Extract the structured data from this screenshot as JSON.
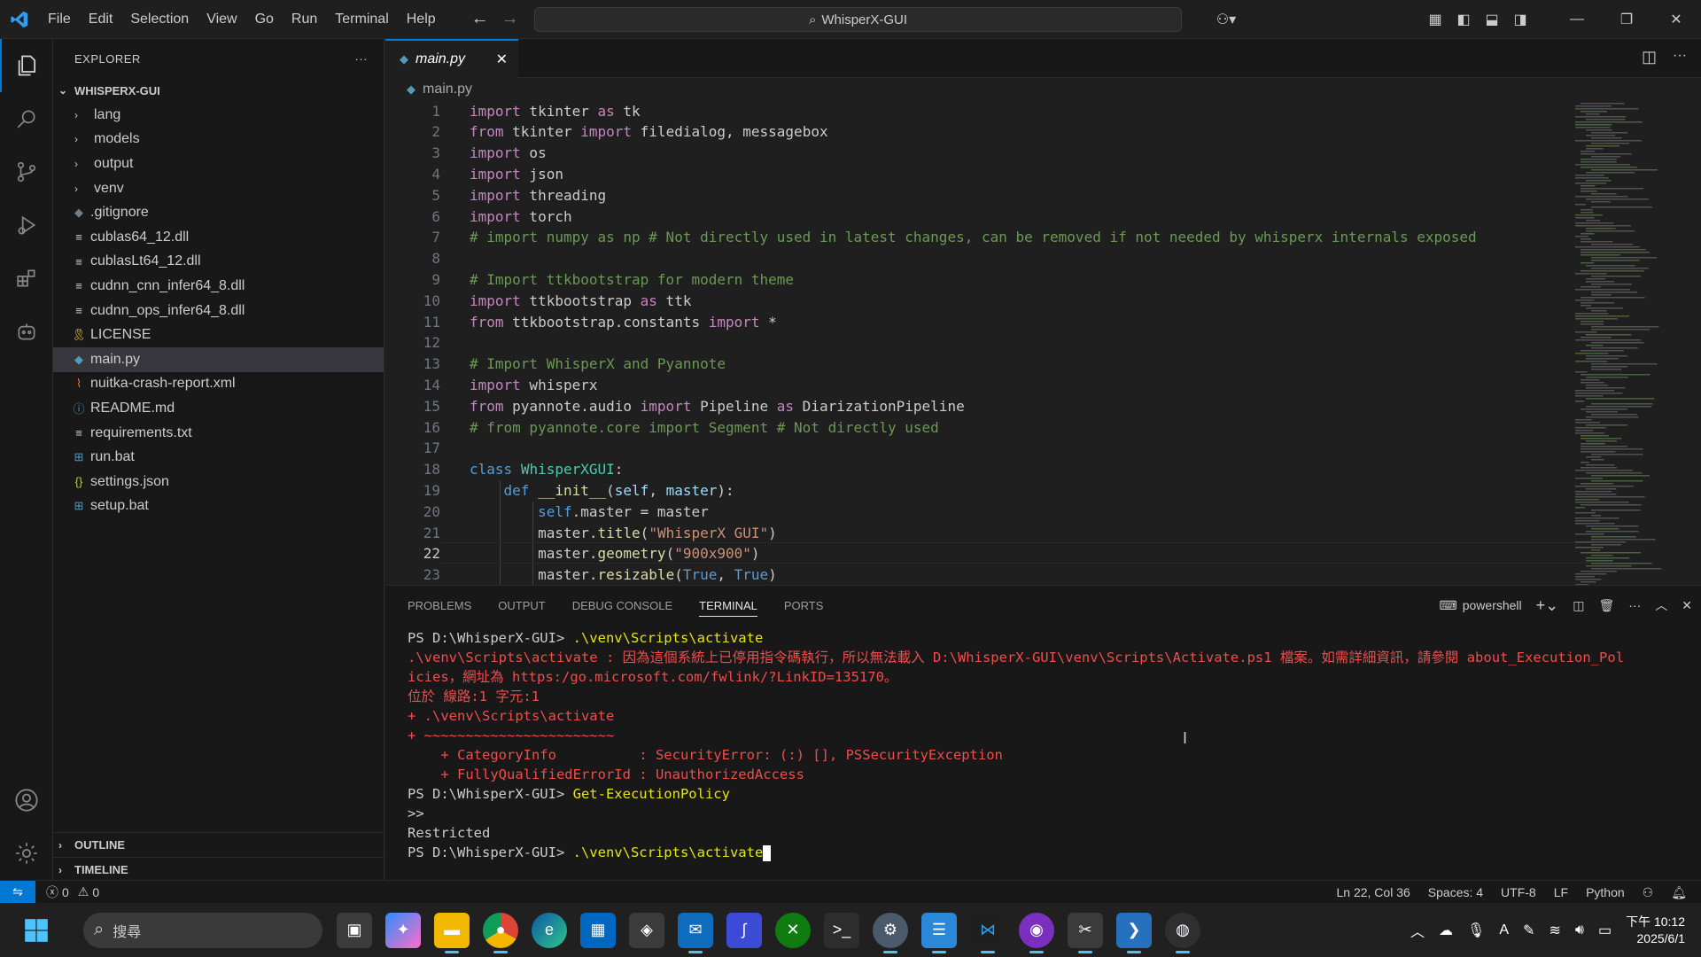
{
  "titlebar": {
    "menus": [
      "File",
      "Edit",
      "Selection",
      "View",
      "Go",
      "Run",
      "Terminal",
      "Help"
    ],
    "search_text": "WhisperX-GUI"
  },
  "explorer": {
    "header": "EXPLORER",
    "root": "WHISPERX-GUI",
    "items": [
      {
        "name": "lang",
        "type": "folder",
        "icon": "folder-chevron"
      },
      {
        "name": "models",
        "type": "folder",
        "icon": "folder-chevron"
      },
      {
        "name": "output",
        "type": "folder",
        "icon": "folder-chevron"
      },
      {
        "name": "venv",
        "type": "folder",
        "icon": "folder-chevron"
      },
      {
        "name": ".gitignore",
        "type": "file",
        "icon": "git-icon",
        "color": "#6d8086"
      },
      {
        "name": "cublas64_12.dll",
        "type": "file",
        "icon": "lines-icon",
        "color": "#cccccc"
      },
      {
        "name": "cublasLt64_12.dll",
        "type": "file",
        "icon": "lines-icon",
        "color": "#cccccc"
      },
      {
        "name": "cudnn_cnn_infer64_8.dll",
        "type": "file",
        "icon": "lines-icon",
        "color": "#cccccc"
      },
      {
        "name": "cudnn_ops_infer64_8.dll",
        "type": "file",
        "icon": "lines-icon",
        "color": "#cccccc"
      },
      {
        "name": "LICENSE",
        "type": "file",
        "icon": "license-icon",
        "color": "#e8c13b"
      },
      {
        "name": "main.py",
        "type": "file",
        "icon": "python-icon",
        "color": "#519aba",
        "selected": true
      },
      {
        "name": "nuitka-crash-report.xml",
        "type": "file",
        "icon": "rss-icon",
        "color": "#e37933"
      },
      {
        "name": "README.md",
        "type": "file",
        "icon": "info-icon",
        "color": "#519aba"
      },
      {
        "name": "requirements.txt",
        "type": "file",
        "icon": "lines-icon",
        "color": "#cccccc"
      },
      {
        "name": "run.bat",
        "type": "file",
        "icon": "windows-icon",
        "color": "#519aba"
      },
      {
        "name": "settings.json",
        "type": "file",
        "icon": "braces-icon",
        "color": "#cbcb41"
      },
      {
        "name": "setup.bat",
        "type": "file",
        "icon": "windows-icon",
        "color": "#519aba"
      }
    ],
    "outline": "OUTLINE",
    "timeline": "TIMELINE"
  },
  "editor": {
    "tab": "main.py",
    "breadcrumb": "main.py",
    "current_line": 22
  },
  "panel": {
    "tabs": [
      "PROBLEMS",
      "OUTPUT",
      "DEBUG CONSOLE",
      "TERMINAL",
      "PORTS"
    ],
    "active_tab": "TERMINAL",
    "shell": "powershell",
    "lines": [
      {
        "prompt": "PS D:\\WhisperX-GUI> ",
        "cmd": ".\\venv\\Scripts\\activate"
      },
      {
        "err": ".\\venv\\Scripts\\activate : 因為這個系統上已停用指令碼執行，所以無法載入 D:\\WhisperX-GUI\\venv\\Scripts\\Activate.ps1 檔案。如需詳細資訊，請參閱 about_Execution_Pol"
      },
      {
        "err": "icies，網址為 https:/go.microsoft.com/fwlink/?LinkID=135170。"
      },
      {
        "err": "位於 線路:1 字元:1"
      },
      {
        "err": "+ .\\venv\\Scripts\\activate"
      },
      {
        "err": "+ ~~~~~~~~~~~~~~~~~~~~~~~"
      },
      {
        "err": "    + CategoryInfo          : SecurityError: (:) [], PSSecurityException"
      },
      {
        "err": "    + FullyQualifiedErrorId : UnauthorizedAccess"
      },
      {
        "prompt": "PS D:\\WhisperX-GUI> ",
        "cmd": "Get-ExecutionPolicy"
      },
      {
        "plain": ">>"
      },
      {
        "plain": "Restricted"
      },
      {
        "prompt": "PS D:\\WhisperX-GUI> ",
        "cmd": ".\\venv\\Scripts\\activate",
        "cursor": true
      }
    ]
  },
  "statusbar": {
    "errors": "0",
    "warnings": "0",
    "position": "Ln 22, Col 36",
    "spaces": "Spaces: 4",
    "encoding": "UTF-8",
    "eol": "LF",
    "language": "Python"
  },
  "taskbar": {
    "search_placeholder": "搜尋",
    "time": "下午 10:12",
    "date": "2025/6/1"
  },
  "colors": {
    "accent": "#0078d4",
    "error": "#f14c4c",
    "command": "#e5e510"
  }
}
